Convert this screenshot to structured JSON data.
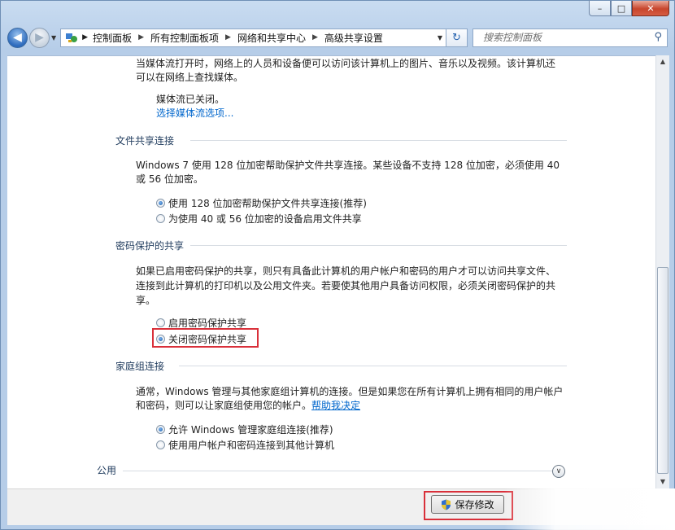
{
  "window": {
    "caption": {
      "minimize": "–",
      "maximize": "□",
      "close": "✕"
    }
  },
  "nav": {
    "back_icon": "back-arrow-icon",
    "forward_icon": "forward-arrow-icon",
    "breadcrumbs": [
      "控制面板",
      "所有控制面板项",
      "网络和共享中心",
      "高级共享设置"
    ],
    "search_placeholder": "搜索控制面板"
  },
  "content": {
    "media": {
      "desc_line1": "当媒体流打开时，网络上的人员和设备便可以访问该计算机上的图片、音乐以及视频。该计算机还",
      "desc_line2": "可以在网络上查找媒体。",
      "status": "媒体流已关闭。",
      "link": "选择媒体流选项..."
    },
    "file_sharing": {
      "title": "文件共享连接",
      "desc_line1": "Windows 7 使用 128 位加密帮助保护文件共享连接。某些设备不支持 128 位加密，必须使用 40",
      "desc_line2": "或 56 位加密。",
      "options": [
        {
          "label": "使用 128 位加密帮助保护文件共享连接(推荐)",
          "selected": true
        },
        {
          "label": "为使用 40 或 56 位加密的设备启用文件共享",
          "selected": false
        }
      ]
    },
    "password_sharing": {
      "title": "密码保护的共享",
      "desc_line1": "如果已启用密码保护的共享，则只有具备此计算机的用户帐户和密码的用户才可以访问共享文件、",
      "desc_line2": "连接到此计算机的打印机以及公用文件夹。若要使其他用户具备访问权限，必须关闭密码保护的共",
      "desc_line3": "享。",
      "options": [
        {
          "label": "启用密码保护共享",
          "selected": false
        },
        {
          "label": "关闭密码保护共享",
          "selected": true
        }
      ]
    },
    "homegroup": {
      "title": "家庭组连接",
      "desc_line1": "通常，Windows 管理与其他家庭组计算机的连接。但是如果您在所有计算机上拥有相同的用户帐户",
      "desc_line2": "和密码，则可以让家庭组使用您的帐户。",
      "help_link": "帮助我决定",
      "options": [
        {
          "label": "允许 Windows 管理家庭组连接(推荐)",
          "selected": true
        },
        {
          "label": "使用用户帐户和密码连接到其他计算机",
          "selected": false
        }
      ]
    },
    "public": {
      "title": "公用"
    }
  },
  "footer": {
    "save_button": "保存修改"
  },
  "colors": {
    "highlight": "#d9303a",
    "link": "#0066cc"
  }
}
